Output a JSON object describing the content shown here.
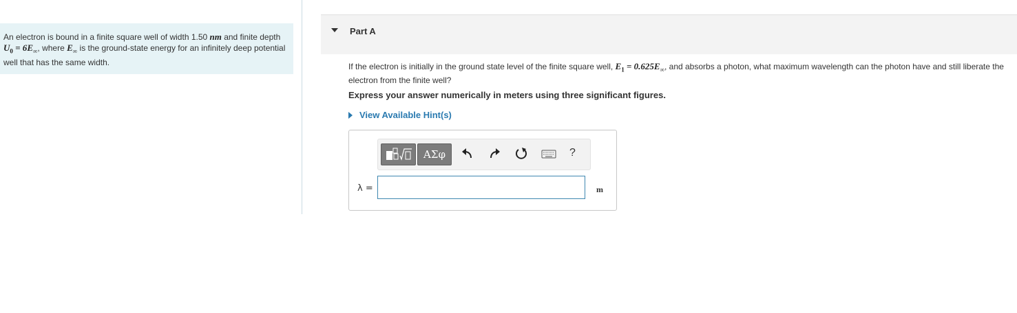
{
  "intro": {
    "segments": [
      {
        "t": "text",
        "v": "An electron is bound in a finite square well of width 1.50 "
      },
      {
        "t": "math",
        "v": "nm",
        "upright": true
      },
      {
        "t": "text",
        "v": " and finite depth "
      },
      {
        "t": "math",
        "v": "U",
        "sub": "0"
      },
      {
        "t": "math",
        "v": " = 6",
        "upright": true
      },
      {
        "t": "math",
        "v": "E",
        "sub": "∞"
      },
      {
        "t": "text",
        "v": ", where "
      },
      {
        "t": "math",
        "v": "E",
        "sub": "∞"
      },
      {
        "t": "text",
        "v": " is the ground-state energy for an infinitely deep potential well that has the same width."
      }
    ]
  },
  "part": {
    "title": "Part A"
  },
  "question": {
    "segments": [
      {
        "t": "text",
        "v": "If the electron is initially in the ground state level of the finite square well, "
      },
      {
        "t": "math",
        "v": "E",
        "sub": "1"
      },
      {
        "t": "math",
        "v": " = 0.625",
        "upright": true
      },
      {
        "t": "math",
        "v": "E",
        "sub": "∞"
      },
      {
        "t": "text",
        "v": ", and absorbs a photon, what maximum wavelength can the photon have and still liberate the electron from the finite well?"
      }
    ]
  },
  "instruction": "Express your answer numerically in meters using three significant figures.",
  "hint_link": "View Available Hint(s)",
  "toolbar": {
    "greek_label": "ΑΣφ",
    "undo_glyph": "↶",
    "redo_glyph": "↷",
    "reset_glyph": "↻",
    "help_label": "?"
  },
  "answer": {
    "variable_label": "λ =",
    "value": "",
    "unit": "m"
  },
  "colors": {
    "left_panel_bg": "#e6f3f6",
    "link": "#2a7ab0",
    "input_border": "#3e87b0"
  }
}
